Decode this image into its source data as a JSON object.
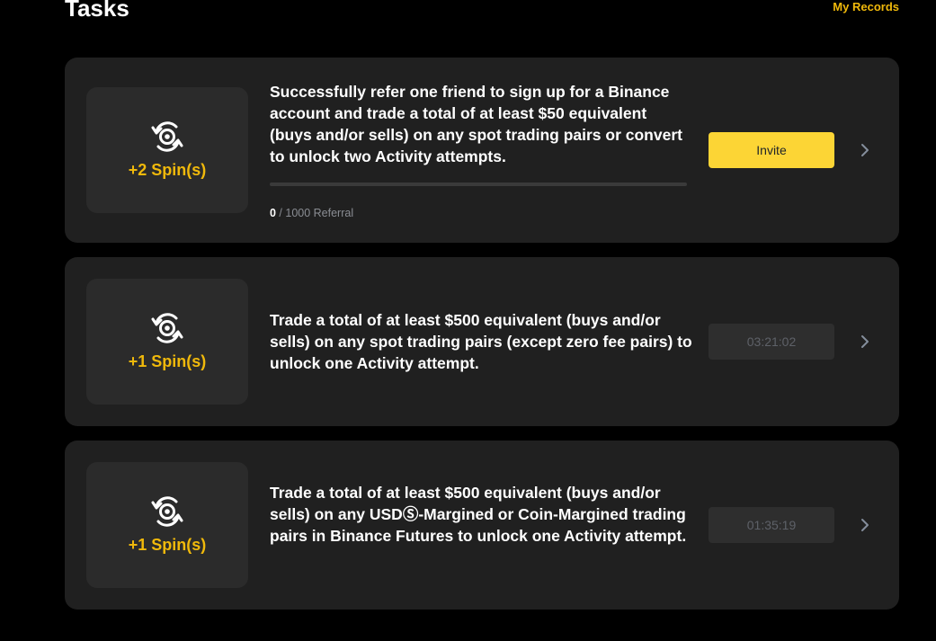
{
  "header": {
    "title": "Tasks",
    "records_link": "My Records"
  },
  "colors": {
    "accent": "#f0b90b",
    "button_yellow": "#fcd535",
    "card_bg": "#202020",
    "reward_bg": "#2b2b2b",
    "page_bg": "#000000"
  },
  "tasks": [
    {
      "reward": "+2 Spin(s)",
      "icon": "spin-refresh-icon",
      "description": "Successfully refer one friend to sign up for a Binance account and trade a total of at least $50 equivalent (buys and/or sells) on any spot trading pairs or convert to unlock two Activity attempts.",
      "progress": {
        "current": "0",
        "rest": " / 1000 Referral",
        "fraction": 0
      },
      "action_label": "Invite"
    },
    {
      "reward": "+1 Spin(s)",
      "icon": "spin-refresh-icon",
      "description": "Trade a total of at least $500 equivalent (buys and/or sells) on any spot trading pairs (except zero fee pairs) to unlock one Activity attempt.",
      "countdown": "03:21:02"
    },
    {
      "reward": "+1 Spin(s)",
      "icon": "spin-refresh-icon",
      "description": "Trade a total of at least $500 equivalent (buys and/or sells) on any USDⓈ-Margined or Coin-Margined trading pairs in Binance Futures to unlock one Activity attempt.",
      "countdown": "01:35:19"
    }
  ]
}
